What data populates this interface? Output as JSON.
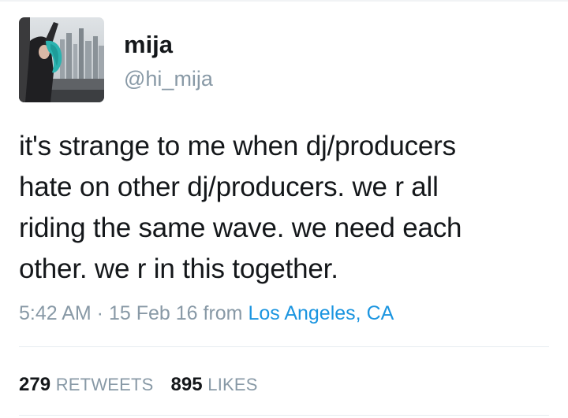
{
  "user": {
    "display_name": "mija",
    "handle": "@hi_mija"
  },
  "tweet": {
    "lines": [
      "it's strange to me when dj/producers",
      "hate on other dj/producers. we r all",
      "riding the same wave. we need each",
      "other. we r in this together."
    ],
    "time": "5:42 AM",
    "separator": " · ",
    "date": "15 Feb 16",
    "from_label": " from ",
    "location": "Los Angeles, CA"
  },
  "stats": {
    "retweets_count": "279",
    "retweets_label": "RETWEETS",
    "likes_count": "895",
    "likes_label": "LIKES"
  },
  "colors": {
    "text": "#14171a",
    "secondary": "#8899a6",
    "link": "#1b95e0",
    "divider": "#e6ecf0",
    "avatar_hair": "#2bb3b0"
  },
  "icons": {
    "avatar": "profile-photo"
  }
}
